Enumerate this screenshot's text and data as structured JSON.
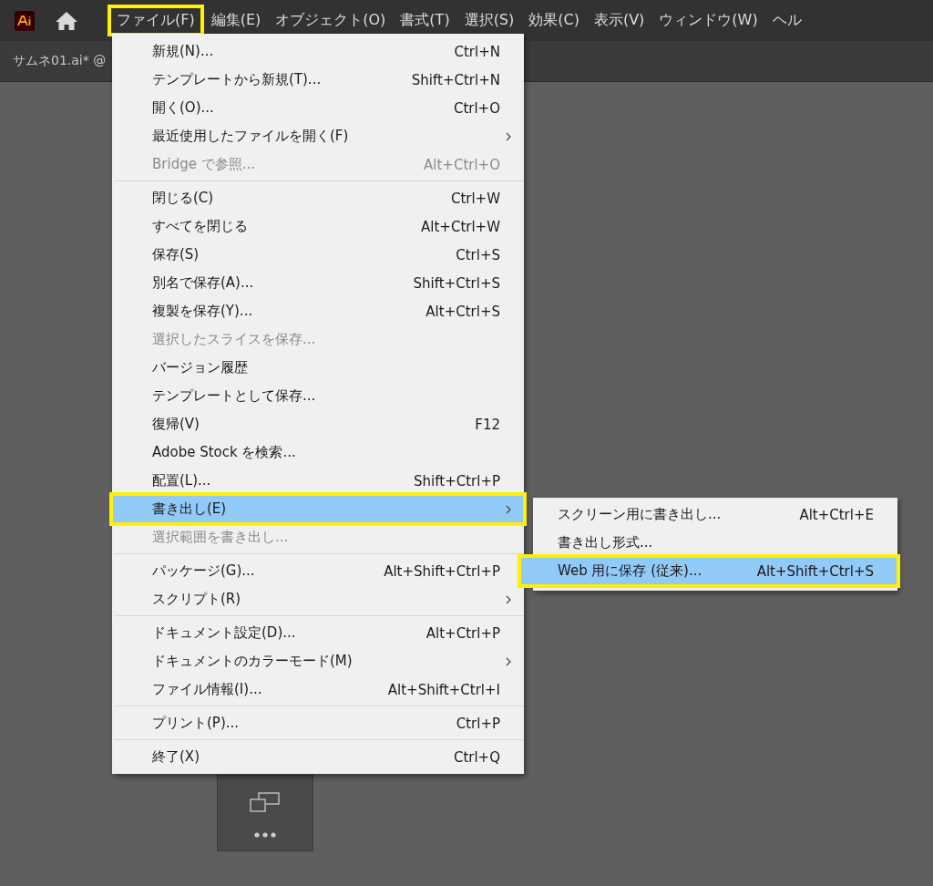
{
  "menu_bar": [
    {
      "label": "ファイル(F)",
      "annotated": true
    },
    {
      "label": "編集(E)",
      "annotated": false
    },
    {
      "label": "オブジェクト(O)",
      "annotated": false
    },
    {
      "label": "書式(T)",
      "annotated": false
    },
    {
      "label": "選択(S)",
      "annotated": false
    },
    {
      "label": "効果(C)",
      "annotated": false
    },
    {
      "label": "表示(V)",
      "annotated": false
    },
    {
      "label": "ウィンドウ(W)",
      "annotated": false
    },
    {
      "label": "ヘル",
      "annotated": false
    }
  ],
  "document_tab": {
    "title": "サムネ01.ai* @"
  },
  "file_menu": [
    {
      "kind": "item",
      "label": "新規(N)...",
      "shortcut": "Ctrl+N",
      "submenu": false,
      "disabled": false,
      "selected": false,
      "annotated": false
    },
    {
      "kind": "item",
      "label": "テンプレートから新規(T)...",
      "shortcut": "Shift+Ctrl+N",
      "submenu": false,
      "disabled": false,
      "selected": false,
      "annotated": false
    },
    {
      "kind": "item",
      "label": "開く(O)...",
      "shortcut": "Ctrl+O",
      "submenu": false,
      "disabled": false,
      "selected": false,
      "annotated": false
    },
    {
      "kind": "item",
      "label": "最近使用したファイルを開く(F)",
      "submenu": true,
      "disabled": false,
      "selected": false,
      "annotated": false
    },
    {
      "kind": "item",
      "label": "Bridge で参照...",
      "shortcut": "Alt+Ctrl+O",
      "submenu": false,
      "disabled": true,
      "selected": false,
      "annotated": false
    },
    {
      "kind": "separator"
    },
    {
      "kind": "item",
      "label": "閉じる(C)",
      "shortcut": "Ctrl+W",
      "submenu": false,
      "disabled": false,
      "selected": false,
      "annotated": false
    },
    {
      "kind": "item",
      "label": "すべてを閉じる",
      "shortcut": "Alt+Ctrl+W",
      "submenu": false,
      "disabled": false,
      "selected": false,
      "annotated": false
    },
    {
      "kind": "item",
      "label": "保存(S)",
      "shortcut": "Ctrl+S",
      "submenu": false,
      "disabled": false,
      "selected": false,
      "annotated": false
    },
    {
      "kind": "item",
      "label": "別名で保存(A)...",
      "shortcut": "Shift+Ctrl+S",
      "submenu": false,
      "disabled": false,
      "selected": false,
      "annotated": false
    },
    {
      "kind": "item",
      "label": "複製を保存(Y)...",
      "shortcut": "Alt+Ctrl+S",
      "submenu": false,
      "disabled": false,
      "selected": false,
      "annotated": false
    },
    {
      "kind": "item",
      "label": "選択したスライスを保存...",
      "submenu": false,
      "disabled": true,
      "selected": false,
      "annotated": false
    },
    {
      "kind": "item",
      "label": "バージョン履歴",
      "submenu": false,
      "disabled": false,
      "selected": false,
      "annotated": false
    },
    {
      "kind": "item",
      "label": "テンプレートとして保存...",
      "submenu": false,
      "disabled": false,
      "selected": false,
      "annotated": false
    },
    {
      "kind": "item",
      "label": "復帰(V)",
      "shortcut": "F12",
      "submenu": false,
      "disabled": false,
      "selected": false,
      "annotated": false
    },
    {
      "kind": "item",
      "label": "Adobe Stock を検索...",
      "submenu": false,
      "disabled": false,
      "selected": false,
      "annotated": false
    },
    {
      "kind": "item",
      "label": "配置(L)...",
      "shortcut": "Shift+Ctrl+P",
      "submenu": false,
      "disabled": false,
      "selected": false,
      "annotated": false
    },
    {
      "kind": "item",
      "label": "書き出し(E)",
      "submenu": true,
      "disabled": false,
      "selected": true,
      "annotated": true
    },
    {
      "kind": "item",
      "label": "選択範囲を書き出し...",
      "submenu": false,
      "disabled": true,
      "selected": false,
      "annotated": false
    },
    {
      "kind": "separator"
    },
    {
      "kind": "item",
      "label": "パッケージ(G)...",
      "shortcut": "Alt+Shift+Ctrl+P",
      "submenu": false,
      "disabled": false,
      "selected": false,
      "annotated": false
    },
    {
      "kind": "item",
      "label": "スクリプト(R)",
      "submenu": true,
      "disabled": false,
      "selected": false,
      "annotated": false
    },
    {
      "kind": "separator"
    },
    {
      "kind": "item",
      "label": "ドキュメント設定(D)...",
      "shortcut": "Alt+Ctrl+P",
      "submenu": false,
      "disabled": false,
      "selected": false,
      "annotated": false
    },
    {
      "kind": "item",
      "label": "ドキュメントのカラーモード(M)",
      "submenu": true,
      "disabled": false,
      "selected": false,
      "annotated": false
    },
    {
      "kind": "item",
      "label": "ファイル情報(I)...",
      "shortcut": "Alt+Shift+Ctrl+I",
      "submenu": false,
      "disabled": false,
      "selected": false,
      "annotated": false
    },
    {
      "kind": "separator"
    },
    {
      "kind": "item",
      "label": "プリント(P)...",
      "shortcut": "Ctrl+P",
      "submenu": false,
      "disabled": false,
      "selected": false,
      "annotated": false
    },
    {
      "kind": "separator"
    },
    {
      "kind": "item",
      "label": "終了(X)",
      "shortcut": "Ctrl+Q",
      "submenu": false,
      "disabled": false,
      "selected": false,
      "annotated": false
    }
  ],
  "export_submenu": [
    {
      "label": "スクリーン用に書き出し...",
      "shortcut": "Alt+Ctrl+E",
      "selected": false,
      "annotated": false
    },
    {
      "label": "書き出し形式...",
      "selected": false,
      "annotated": false
    },
    {
      "label": "Web 用に保存 (従来)...",
      "shortcut": "Alt+Shift+Ctrl+S",
      "selected": true,
      "annotated": true
    }
  ]
}
